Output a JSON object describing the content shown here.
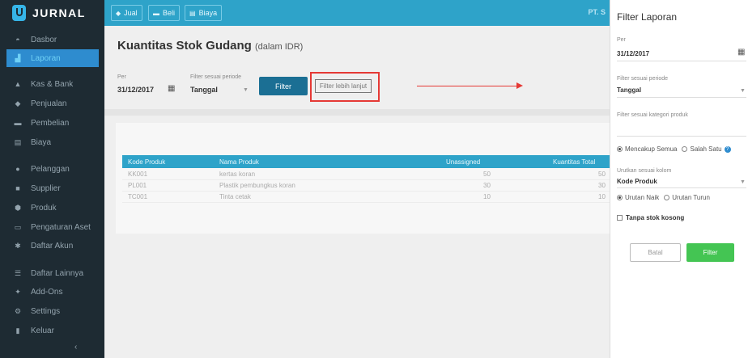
{
  "brand": "JURNAL",
  "sidebar": {
    "items": [
      {
        "label": "Dasbor",
        "icon": "dashboard-icon"
      },
      {
        "label": "Laporan",
        "icon": "chart-icon",
        "active": true
      },
      {
        "label": "Kas & Bank",
        "icon": "bank-icon"
      },
      {
        "label": "Penjualan",
        "icon": "tag-icon"
      },
      {
        "label": "Pembelian",
        "icon": "card-icon"
      },
      {
        "label": "Biaya",
        "icon": "receipt-icon"
      },
      {
        "label": "Pelanggan",
        "icon": "users-icon"
      },
      {
        "label": "Supplier",
        "icon": "truck-icon"
      },
      {
        "label": "Produk",
        "icon": "box-icon"
      },
      {
        "label": "Pengaturan Aset",
        "icon": "asset-icon"
      },
      {
        "label": "Daftar Akun",
        "icon": "account-icon"
      },
      {
        "label": "Daftar Lainnya",
        "icon": "list-icon"
      },
      {
        "label": "Add-Ons",
        "icon": "puzzle-icon"
      },
      {
        "label": "Settings",
        "icon": "gear-icon"
      },
      {
        "label": "Keluar",
        "icon": "logout-icon"
      }
    ],
    "collapse": "‹"
  },
  "topbar": {
    "buttons": [
      {
        "label": "Jual",
        "icon": "tag-icon"
      },
      {
        "label": "Beli",
        "icon": "card-icon"
      },
      {
        "label": "Biaya",
        "icon": "receipt-icon"
      }
    ],
    "company": "PT. S"
  },
  "main": {
    "title": "Kuantitas Stok Gudang",
    "title_sub": "(dalam IDR)",
    "per_label": "Per",
    "per_value": "31/12/2017",
    "period_label": "Filter sesuai periode",
    "period_value": "Tanggal",
    "filter_button": "Filter",
    "advanced_filter_button": "Filter lebih lanjut",
    "table": {
      "headers": [
        "Kode Produk",
        "Nama Produk",
        "Unassigned",
        "Kuantitas Total"
      ],
      "rows": [
        [
          "KK001",
          "kertas koran",
          "50",
          "50"
        ],
        [
          "PL001",
          "Plastik pembungkus koran",
          "30",
          "30"
        ],
        [
          "TC001",
          "Tinta cetak",
          "10",
          "10"
        ]
      ]
    }
  },
  "panel": {
    "title": "Filter Laporan",
    "per_label": "Per",
    "per_value": "31/12/2017",
    "period_label": "Filter sesuai periode",
    "period_value": "Tanggal",
    "category_label": "Filter sesuai kategori produk",
    "radio_all": "Mencakup Semua",
    "radio_one": "Salah Satu",
    "sort_label": "Urutkan sesuai kolom",
    "sort_value": "Kode Produk",
    "radio_asc": "Urutan Naik",
    "radio_desc": "Urutan Turun",
    "checkbox_label": "Tanpa stok kosong",
    "cancel_button": "Batal",
    "filter_button": "Filter"
  },
  "colors": {
    "sidebar": "#1e2b33",
    "topbar": "#2ea3c9",
    "highlight": "#e53935",
    "primary_button": "#1b6f94",
    "green_button": "#44c553"
  }
}
